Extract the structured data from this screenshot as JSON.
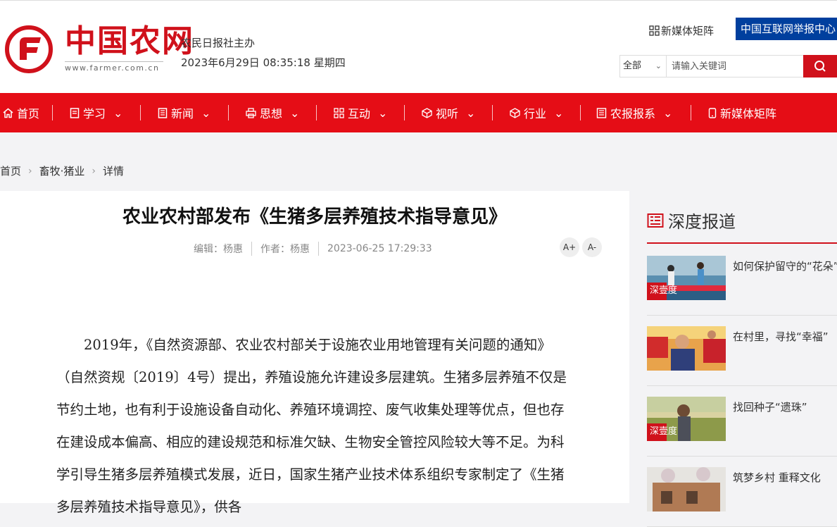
{
  "header": {
    "logo_text": "中国农网",
    "logo_url": "www.farmer.com.cn",
    "sponsor": "农民日报社主办",
    "datetime": "2023年6月29日 08:35:18 星期四",
    "media_matrix_label": "新媒体矩阵",
    "report_center_label": "中国互联网举报中心",
    "search": {
      "scope": "全部",
      "placeholder": "请输入关键词"
    }
  },
  "nav": {
    "items": [
      {
        "label": "首页",
        "icon": "home-icon",
        "has_dropdown": false
      },
      {
        "label": "学习",
        "icon": "book-icon",
        "has_dropdown": true
      },
      {
        "label": "新闻",
        "icon": "news-icon",
        "has_dropdown": true
      },
      {
        "label": "思想",
        "icon": "print-icon",
        "has_dropdown": true
      },
      {
        "label": "互动",
        "icon": "grid-icon",
        "has_dropdown": true
      },
      {
        "label": "视听",
        "icon": "cube-icon",
        "has_dropdown": true
      },
      {
        "label": "行业",
        "icon": "box-icon",
        "has_dropdown": true
      },
      {
        "label": "农报报系",
        "icon": "newspaper-icon",
        "has_dropdown": true
      },
      {
        "label": "新媒体矩阵",
        "icon": "mobile-icon",
        "has_dropdown": false
      }
    ]
  },
  "breadcrumb": [
    "首页",
    "畜牧·猪业",
    "详情"
  ],
  "article": {
    "title": "农业农村部发布《生猪多层养殖技术指导意见》",
    "editor": "编辑：杨惠",
    "author": "作者：杨惠",
    "date": "2023-06-25 17:29:33",
    "font_increase": "A+",
    "font_decrease": "A-",
    "body": "2019年，《自然资源部、农业农村部关于设施农业用地管理有关问题的通知》（自然资规〔2019〕4号）提出，养殖设施允许建设多层建筑。生猪多层养殖不仅是节约土地，也有利于设施设备自动化、养殖环境调控、废气收集处理等优点，但也存在建设成本偏高、相应的建设规范和标准欠缺、生物安全管控风险较大等不足。为科学引导生猪多层养殖模式发展，近日，国家生猪产业技术体系组织专家制定了《生猪多层养殖技术指导意见》，供各"
  },
  "sidebar": {
    "heading": "深度报道",
    "items": [
      {
        "title": "如何保护留守的“花朵”",
        "thumb_caption": "深壹度"
      },
      {
        "title": "在村里，寻找“幸福”",
        "thumb_caption": ""
      },
      {
        "title": "找回种子“遗珠”",
        "thumb_caption": "深壹度"
      },
      {
        "title": "筑梦乡村 重释文化",
        "thumb_caption": ""
      }
    ]
  },
  "colors": {
    "brand_red": "#e50d16",
    "report_blue": "#003f9e"
  }
}
